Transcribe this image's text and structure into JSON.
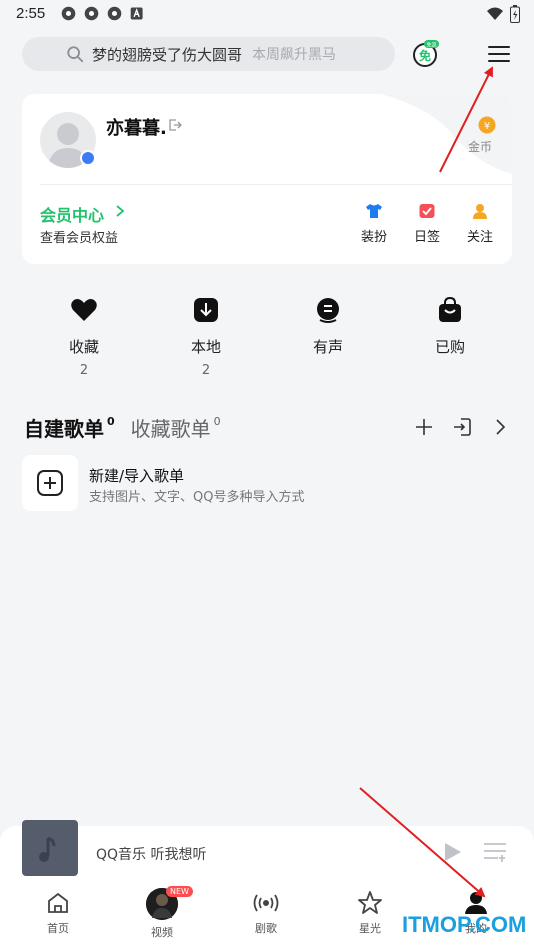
{
  "status_bar": {
    "time": "2:55"
  },
  "search": {
    "text": "梦的翅膀受了伤大圆哥",
    "hint": "本周飙升黑马"
  },
  "header": {
    "free_badge": "免",
    "free_badge_tag": "免流",
    "menu_icon": "menu-icon"
  },
  "profile": {
    "username": "亦暮暮.",
    "coin_label": "金币",
    "vip_title": "会员中心",
    "vip_sub": "查看会员权益",
    "quick": [
      {
        "label": "装扮",
        "icon": "tshirt-icon",
        "color": "#1e7cf2"
      },
      {
        "label": "日签",
        "icon": "calendar-check-icon",
        "color": "#f5505a"
      },
      {
        "label": "关注",
        "icon": "person-icon",
        "color": "#f5a623"
      }
    ]
  },
  "tiles": [
    {
      "label": "收藏",
      "count": "2",
      "icon": "heart-icon"
    },
    {
      "label": "本地",
      "count": "2",
      "icon": "download-icon"
    },
    {
      "label": "有声",
      "count": "",
      "icon": "audio-icon"
    },
    {
      "label": "已购",
      "count": "",
      "icon": "bag-icon"
    }
  ],
  "playlists": {
    "tab_created": "自建歌单",
    "tab_created_count": "0",
    "tab_collected": "收藏歌单",
    "tab_collected_count": "0",
    "new_title": "新建/导入歌单",
    "new_sub": "支持图片、文字、QQ号多种导入方式"
  },
  "player": {
    "text": "QQ音乐 听我想听"
  },
  "tabbar": {
    "items": [
      {
        "label": "首页",
        "icon": "home-icon"
      },
      {
        "label": "视频",
        "icon": "video-avatar"
      },
      {
        "label": "剧歌",
        "icon": "broadcast-icon"
      },
      {
        "label": "星光",
        "icon": "star-icon"
      },
      {
        "label": "我的",
        "icon": "person-icon"
      }
    ],
    "new_tag": "NEW"
  },
  "watermark": "ITMOP.COM",
  "colors": {
    "accent_green": "#22c26b",
    "arrow_red": "#e02020"
  }
}
